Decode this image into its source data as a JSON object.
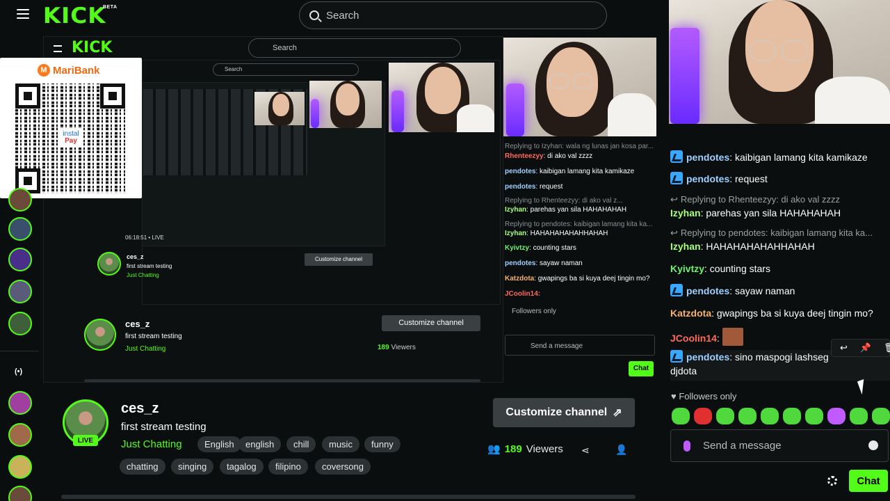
{
  "header": {
    "logo_text": "KICK",
    "beta_label": "BETA",
    "search_placeholder": "Search"
  },
  "sponsor": {
    "brand": "MariBank",
    "brand_icon": "M",
    "qr_center_top": "instal",
    "qr_center_bottom": "Pay"
  },
  "channel": {
    "name": "ces_z",
    "title": "first stream testing",
    "category": "Just Chatting",
    "live_label": "LIVE",
    "tags": [
      "English",
      "english",
      "chill",
      "music",
      "funny",
      "chatting",
      "singing",
      "tagalog",
      "filipino",
      "coversong"
    ],
    "customize_label": "Customize channel",
    "viewers_count": "189",
    "viewers_label": "Viewers"
  },
  "chat": {
    "messages": [
      {
        "user": "pendotes",
        "text": ": kaibigan lamang kita kamikaze"
      },
      {
        "user": "pendotes",
        "text": ": request"
      },
      {
        "reply_to": "Replying to Rhenteezyy: di ako val zzzz"
      },
      {
        "user": "Izyhan",
        "text": ": parehas yan sila HAHAHAHAH"
      },
      {
        "reply_to": "Replying to pendotes: kaibigan lamang kita ka..."
      },
      {
        "user": "Izyhan",
        "text": ": HAHAHAHAHAHHAHAH"
      },
      {
        "user": "Kyivtzy",
        "text": ": counting stars"
      },
      {
        "user": "pendotes",
        "text": ": sayaw naman"
      },
      {
        "user": "Katzdota",
        "text": ": gwapings ba si kuya deej tingin mo?"
      },
      {
        "user": "JCoolin14",
        "text": ":"
      },
      {
        "user": "pendotes",
        "text": ": sino maspogi lashseg",
        "text2": "djdota"
      }
    ],
    "followers_only": "Followers only",
    "input_placeholder": "Send a message",
    "send_label": "Chat"
  },
  "nested": {
    "search_1": "Search",
    "search_2": "Search",
    "replying_lizyhan": "Replying to Izyhan: wala ng lunas jan kosa par...",
    "rhenteezyy": "Rhenteezyy",
    "rhen_text": ": di ako val zzzz",
    "pend_kamikaze": ": kaibigan lamang kita kamikaze",
    "pend_request": ": request",
    "replying_rhen": "Replying to Rhenteezyy: di ako val z...",
    "iz_parehas": ": parehas yan sila HAHAHAHAH",
    "replying_pend": "Replying to pendotes: kaibigan lamang kita ka...",
    "iz_haha": ": HAHAHAHAHAHHAHAH",
    "kiv_counting": ": counting stars",
    "pend_sayaw": ": sayaw naman",
    "kat_gwapings": ": gwapings ba si kuya deej tingin mo?",
    "jc": "JCoolin14:",
    "followers_only": "Followers only",
    "send": "Send a message",
    "chat_btn": "Chat",
    "customize": "Customize channel",
    "name": "ces_z",
    "title": "first stream testing",
    "category": "Just Chatting",
    "viewers_count": "189",
    "viewers_label": "Viewers",
    "tags": [
      "English",
      "english",
      "chill",
      "music",
      "funny",
      "chatting",
      "singing",
      "tagalog",
      "filipino",
      "coversong"
    ],
    "time": "06:18:51",
    "live": "LIVE"
  },
  "colors": {
    "brand_green": "#53fc18",
    "background": "#0b0e0f",
    "pendotes": "#9fd0ff",
    "izyhan": "#a8ff7a",
    "katzdota": "#f7b26a",
    "jcoolin": "#ff6a5a"
  }
}
